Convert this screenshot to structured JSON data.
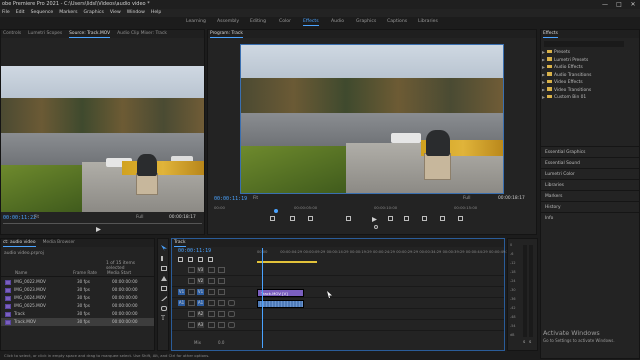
{
  "app": {
    "title": "obe Premiere Pro 2021 - C:\\Users\\lidsl\\Videos\\audio video *",
    "window_buttons": [
      "—",
      "□",
      "✕"
    ]
  },
  "menu": [
    "File",
    "Edit",
    "Sequence",
    "Markers",
    "Graphics",
    "View",
    "Window",
    "Help"
  ],
  "workspaces": [
    "Learning",
    "Assembly",
    "Editing",
    "Color",
    "Effects",
    "Audio",
    "Graphics",
    "Captions",
    "Libraries"
  ],
  "active_workspace": "Effects",
  "source_panel": {
    "tabs": [
      "Controls",
      "Lumetri Scopes",
      "Source: Track.MOV",
      "Audio Clip Mixer: Track"
    ],
    "active_tab": "Source: Track.MOV",
    "timecode": "00:00:11:22",
    "fit": "Fit",
    "quality": "Full",
    "duration": "00:00:18:17"
  },
  "program_panel": {
    "title": "Program: Track",
    "timecode": "00:00:11:19",
    "fit": "Fit",
    "quality": "Full",
    "duration": "00:00:18:17",
    "ruler": [
      "00:00",
      "00:00:05:00",
      "00:00:10:00",
      "00:00:15:00"
    ]
  },
  "project_panel": {
    "tabs": [
      "ct: audio video",
      "Media Browser"
    ],
    "path": "audio video.prproj",
    "count": "1 of 15 items selected",
    "headers": [
      "Name",
      "Frame Rate",
      "Media Start"
    ],
    "items": [
      {
        "name": "IMG_0022.MOV",
        "rate": "30 fps",
        "start": "00:00:00:00"
      },
      {
        "name": "IMG_0023.MOV",
        "rate": "30 fps",
        "start": "00:00:00:00"
      },
      {
        "name": "IMG_0024.MOV",
        "rate": "30 fps",
        "start": "00:00:00:00"
      },
      {
        "name": "IMG_0025.MOV",
        "rate": "30 fps",
        "start": "00:00:00:00"
      },
      {
        "name": "Track",
        "rate": "30 fps",
        "start": "00:00:00:00"
      },
      {
        "name": "Track.MOV",
        "rate": "30 fps",
        "start": "00:00:00:00"
      }
    ]
  },
  "timeline": {
    "tab": "Track",
    "timecode": "00:00:11:19",
    "ruler": [
      "00:00",
      "00:00:04:29",
      "00:00:09:29",
      "00:00:14:29",
      "00:00:19:29",
      "00:00:24:29",
      "00:00:29:29",
      "00:00:34:29",
      "00:00:39:29",
      "00:00:44:29",
      "00:00:49:29"
    ],
    "tracks": [
      "V3",
      "V2",
      "V1",
      "A1",
      "A2",
      "A3"
    ],
    "source_patch": [
      "V1",
      "A1"
    ],
    "master": "Mix",
    "master_value": "0.0",
    "clips": [
      {
        "label": "Track.MOV [V]",
        "type": "video"
      },
      {
        "label": "",
        "type": "audio"
      }
    ]
  },
  "effects_panel": {
    "title": "Effects",
    "items": [
      "Presets",
      "Lumetri Presets",
      "Audio Effects",
      "Audio Transitions",
      "Video Effects",
      "Video Transitions",
      "Custom Bin 01"
    ],
    "sections": [
      "Essential Graphics",
      "Essential Sound",
      "Lumetri Color",
      "Libraries",
      "Markers",
      "History",
      "Info"
    ]
  },
  "meter_scale": [
    "0",
    "-6",
    "-12",
    "-18",
    "-24",
    "-30",
    "-36",
    "-42",
    "-48",
    "-54",
    "dB"
  ],
  "meter_channels": [
    "S",
    "S"
  ],
  "status_bar": "Click to select, or click in empty space and drag to marquee select. Use Shift, Alt, and Ctrl for other options.",
  "watermark": {
    "line1": "Activate Windows",
    "line2": "Go to Settings to activate Windows."
  },
  "colors": {
    "accent": "#4aa3ff",
    "video_clip": "#7b5fbf",
    "audio_clip": "#4f7bb8",
    "playhead": "#4aa3ff"
  }
}
